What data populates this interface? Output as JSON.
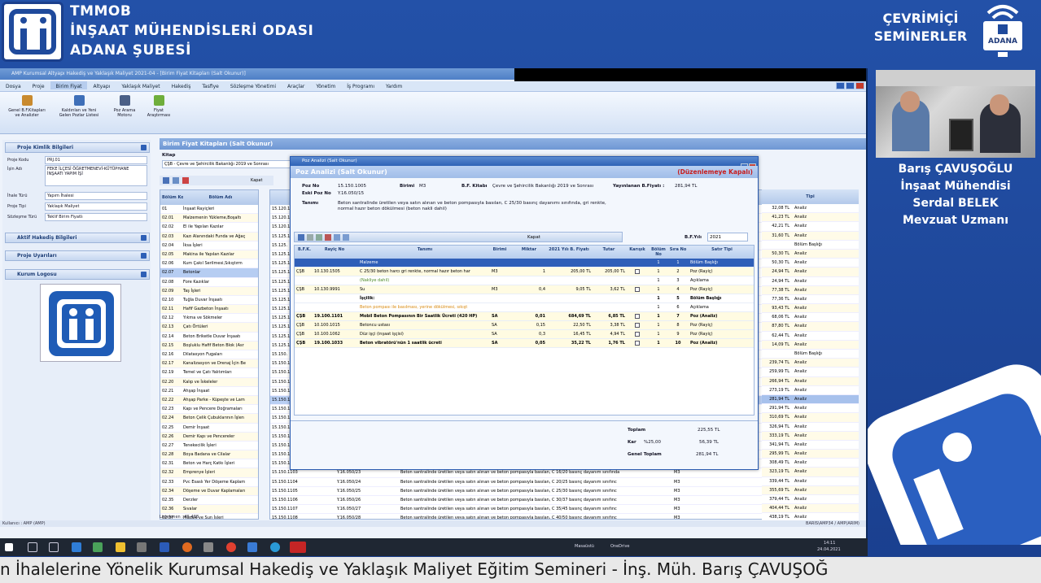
{
  "header": {
    "line1": "TMMOB",
    "line2": "İNŞAAT MÜHENDİSLERİ ODASI",
    "line3": "ADANA ŞUBESİ",
    "right_line1": "ÇEVRİMİÇİ",
    "right_line2": "SEMİNERLER",
    "right_badge": "ADANA"
  },
  "app": {
    "title": "AMP Kurumsal Altyapı Hakediş ve Yaklaşık Maliyet 2021-04 - [Birim Fiyat Kitapları (Salt Okunur)]",
    "menu": [
      "Dosya",
      "Proje",
      "Birim Fiyat",
      "Altyapı",
      "Yaklaşık Maliyet",
      "Hakediş",
      "Tasfiye",
      "Sözleşme Yönetimi",
      "Araçlar",
      "Yönetim",
      "İş Programı",
      "Yardım"
    ],
    "ribbon": [
      {
        "l1": "Genel B.F.Kitapları",
        "l2": "ve Analizler",
        "color": "#c98a2e"
      },
      {
        "l1": "Kaldırılan ve Yeni",
        "l2": "Gelen Pozlar Listesi",
        "color": "#3e6fb8"
      },
      {
        "l1": "Poz Arama",
        "l2": "Motoru",
        "color": "#4a5f86"
      },
      {
        "l1": "Fiyat",
        "l2": "Araştırması",
        "color": "#6fae3b"
      }
    ]
  },
  "left": {
    "g1": "Proje Kimlik Bilgileri",
    "proje_kodu_l": "Proje Kodu",
    "proje_kodu": "PRJ.01",
    "isin_adi_l": "İşin Adı",
    "isin_adi": "FEKE İLÇESİ ÖĞRETMENEVİ-KÜTÜPHANE İNŞAATI YAPIM İŞİ",
    "ihale_turu_l": "İhale Türü",
    "ihale_turu": "Yapım İhalesi",
    "proje_tipi_l": "Proje Tipi",
    "proje_tipi": "Yaklaşık Maliyet",
    "sozlesme_turu_l": "Sözleşme Türü",
    "sozlesme_turu": "Teklif Birim Fiyatlı",
    "g2": "Aktif Hakediş Bilgileri",
    "g3": "Proje Uyarıları",
    "g4": "Kurum Logosu"
  },
  "bfk": {
    "title": "Birim Fiyat Kitapları (Salt Okunur)",
    "kitap_l": "Kitap",
    "kitap": "ÇŞB - Çevre ve Şehircilik Bakanlığı 2019 ve Sonrası",
    "kapat": "Kapat",
    "col_kod": "Bölüm Kodu",
    "col_adi": "Bölüm Adı",
    "col_tipi": "Tipi",
    "listeler": "Listelenen : 45.498",
    "status_left": "Kullanıcı : AMP (AMP)",
    "status_right": "BARIS\\AMP34 / AMP(ARIM)",
    "rows": [
      [
        "01",
        "İnşaat Rayiçleri"
      ],
      [
        "02.01",
        "Malzemenin Yükleme,Boşaltı"
      ],
      [
        "02.02",
        "El ile Yapılan Kazılar"
      ],
      [
        "02.03",
        "Kazı Alanındaki Funda ve Ağaç"
      ],
      [
        "02.04",
        "İksa İşleri"
      ],
      [
        "02.05",
        "Makina ile Yapılan Kazılar"
      ],
      [
        "02.06",
        "Kum Çakıl Serilmesi,Sıkıştırm"
      ],
      [
        "02.07",
        "Betonlar"
      ],
      [
        "02.08",
        "Fore Kazıklar"
      ],
      [
        "02.09",
        "Taş İşleri"
      ],
      [
        "02.10",
        "Tuğla Duvar İnşaatı"
      ],
      [
        "02.11",
        "Hafif Gazbeton İnşaatı"
      ],
      [
        "02.12",
        "Yıkma ve Sökmeler"
      ],
      [
        "02.13",
        "Çatı Örtüleri"
      ],
      [
        "02.14",
        "Beton Briketle Duvar İnşaatı"
      ],
      [
        "02.15",
        "Boşluklu Hafif Beton Blok (Asr"
      ],
      [
        "02.16",
        "Dilatasyon Fugaları"
      ],
      [
        "02.17",
        "Kanalizasyon ve Drenaj İçin Be"
      ],
      [
        "02.19",
        "Temel ve Çatı Yalıtımları"
      ],
      [
        "02.20",
        "Kalıp ve İskeleler"
      ],
      [
        "02.21",
        "Ahşap İnşaat"
      ],
      [
        "02.22",
        "Ahşap Parke - Küpeşte ve Lam"
      ],
      [
        "02.23",
        "Kapı ve Pencere Doğramaları"
      ],
      [
        "02.24",
        "Beton Çelik Çubuklarının İşlen"
      ],
      [
        "02.25",
        "Demir İnşaat"
      ],
      [
        "02.26",
        "Demir Kapı ve Pencereler"
      ],
      [
        "02.27",
        "Tenekecilik İşleri"
      ],
      [
        "02.28",
        "Boya Badana ve Cilalar"
      ],
      [
        "02.31",
        "Beton ve Harç Katkı İşleri"
      ],
      [
        "02.32",
        "Emprenye İşleri"
      ],
      [
        "02.33",
        "Pvc Esaslı Yer Döşeme Kaplam"
      ],
      [
        "02.34",
        "Döşeme ve Duvar Kaplamaları"
      ],
      [
        "02.35",
        "Derzler"
      ],
      [
        "02.36",
        "Sıvalar"
      ],
      [
        "02.37",
        "Mozaik ve Sun İşleri"
      ]
    ],
    "mid": [
      [
        "15.120.1",
        "",
        ""
      ],
      [
        "15.120.1",
        "",
        ""
      ],
      [
        "15.120.1",
        "",
        ""
      ],
      [
        "15.125.1",
        "",
        ""
      ],
      [
        "15.125.",
        "",
        ""
      ],
      [
        "15.125.1",
        "",
        ""
      ],
      [
        "15.125.1",
        "",
        ""
      ],
      [
        "15.125.1",
        "",
        ""
      ],
      [
        "15.125.1",
        "",
        ""
      ],
      [
        "15.125.1",
        "",
        ""
      ],
      [
        "15.125.1",
        "",
        ""
      ],
      [
        "15.125.1",
        "",
        ""
      ],
      [
        "15.125.1",
        "",
        ""
      ],
      [
        "15.125.1",
        "",
        ""
      ],
      [
        "15.125.1",
        "",
        ""
      ],
      [
        "15.125.1",
        "",
        ""
      ],
      [
        "15.150.",
        "",
        ""
      ],
      [
        "15.150.1",
        "",
        ""
      ],
      [
        "15.150.1",
        "",
        ""
      ],
      [
        "15.150.1",
        "",
        ""
      ],
      [
        "15.150.1",
        "",
        ""
      ],
      [
        "15.150.1",
        "",
        ""
      ],
      [
        "15.150.1",
        "",
        ""
      ],
      [
        "15.150.1",
        "",
        ""
      ],
      [
        "15.150.1",
        "",
        ""
      ],
      [
        "15.150.1",
        "",
        ""
      ],
      [
        "15.150.1",
        "",
        ""
      ],
      [
        "15.150.1",
        "",
        ""
      ],
      [
        "15.150.1",
        "",
        ""
      ],
      [
        "15.150.1103",
        "Y.16.050/23",
        "Beton santralinde üretilen veya satın alınan ve beton pompasıyla basılan, C 16/20 basınç dayanım sınıfında",
        "M3"
      ],
      [
        "15.150.1104",
        "Y.16.050/24",
        "Beton santralinde üretilen veya satın alınan ve beton pompasıyla basılan, C 20/25 basınç dayanım sınıfınc",
        "M3"
      ],
      [
        "15.150.1105",
        "Y.16.050/25",
        "Beton santralinde üretilen veya satın alınan ve beton pompasıyla basılan, C 25/30 basınç dayanım sınıfınc",
        "M3"
      ],
      [
        "15.150.1106",
        "Y.16.050/26",
        "Beton santralinde üretilen veya satın alınan ve beton pompasıyla basılan, C 30/37 basınç dayanım sınıfınc",
        "M3"
      ],
      [
        "15.150.1107",
        "Y.16.050/27",
        "Beton santralinde üretilen veya satın alınan ve beton pompasıyla basılan, C 35/45 basınç dayanım sınıfınc",
        "M3"
      ],
      [
        "15.150.1108",
        "Y.16.050/28",
        "Beton santralinde üretilen veya satın alınan ve beton pompasıyla basılan, C 40/50 basınç dayanım sınıfınc",
        "M3"
      ]
    ],
    "right": [
      [
        "32,08 TL",
        "Analiz"
      ],
      [
        "41,23 TL",
        "Analiz"
      ],
      [
        "42,21 TL",
        "Analiz"
      ],
      [
        "31,60 TL",
        "Analiz"
      ],
      [
        "",
        "Bölüm Başlığı"
      ],
      [
        "50,30 TL",
        "Analiz"
      ],
      [
        "50,30 TL",
        "Analiz"
      ],
      [
        "24,94 TL",
        "Analiz"
      ],
      [
        "24,94 TL",
        "Analiz"
      ],
      [
        "77,38 TL",
        "Analiz"
      ],
      [
        "77,36 TL",
        "Analiz"
      ],
      [
        "93,43 TL",
        "Analiz"
      ],
      [
        "68,06 TL",
        "Analiz"
      ],
      [
        "87,80 TL",
        "Analiz"
      ],
      [
        "62,44 TL",
        "Analiz"
      ],
      [
        "14,09 TL",
        "Analiz"
      ],
      [
        "",
        "Bölüm Başlığı"
      ],
      [
        "239,74 TL",
        "Analiz"
      ],
      [
        "259,99 TL",
        "Analiz"
      ],
      [
        "266,94 TL",
        "Analiz"
      ],
      [
        "273,19 TL",
        "Analiz"
      ],
      [
        "281,94 TL",
        "Analiz"
      ],
      [
        "291,94 TL",
        "Analiz"
      ],
      [
        "310,69 TL",
        "Analiz"
      ],
      [
        "326,94 TL",
        "Analiz"
      ],
      [
        "333,19 TL",
        "Analiz"
      ],
      [
        "341,94 TL",
        "Analiz"
      ],
      [
        "295,99 TL",
        "Analiz"
      ],
      [
        "308,49 TL",
        "Analiz"
      ],
      [
        "323,19 TL",
        "Analiz"
      ],
      [
        "339,44 TL",
        "Analiz"
      ],
      [
        "355,69 TL",
        "Analiz"
      ],
      [
        "379,44 TL",
        "Analiz"
      ],
      [
        "404,44 TL",
        "Analiz"
      ],
      [
        "438,19 TL",
        "Analiz"
      ]
    ]
  },
  "dialog": {
    "window_title": "Poz Analizi (Salt Okunur)",
    "title": "Poz Analizi (Salt Okunur)",
    "warning": "(Düzenlemeye Kapalı)",
    "poz_no_l": "Poz No",
    "poz_no": "15.150.1005",
    "eski_poz_l": "Eski Poz No",
    "eski_poz": "Y.16.050/15",
    "birimi_l": "Birimi",
    "birimi": "M3",
    "bfk_l": "B.F. Kitabı",
    "bfk": "Çevre ve Şehircilik Bakanlığı 2019 ve Sonrası",
    "yay_l": "Yayınlanan B.Fiyatı :",
    "yay": "281,94 TL",
    "tanimi_l": "Tanımı",
    "tanimi": "Beton santralinde üretilen veya satın alınan ve beton pompasıyla basılan, C 25/30 basınç dayanımı sınıfında, gri renkte, normal hazır beton dökülmesi (beton nakli dahil)",
    "kapat": "Kapat",
    "bfyili_l": "B.F.Yılı",
    "bfyili": "2021",
    "cols": [
      "B.F.K.",
      "Rayiç No",
      "Tanımı",
      "Birimi",
      "Miktar",
      "2021 Yılı B. Fiyatı",
      "Tutar",
      "Karışık",
      "Bölüm No",
      "Sıra No",
      "Satır Tipi"
    ],
    "rows": [
      {
        "cls": "hdr",
        "bfk": "",
        "no": "",
        "t": "Malzeme",
        "b": "",
        "m": "",
        "f": "",
        "tu": "",
        "bn": "1",
        "sn": "1",
        "st": "Bölüm Başlığı"
      },
      {
        "cls": "yel",
        "bfk": "ÇŞB",
        "no": "10.130.1505",
        "t": "C 25/30 beton harcı gri renkte, normal hazır beton har",
        "b": "M3",
        "m": "1",
        "f": "205,00 TL",
        "tu": "205,00 TL",
        "bn": "1",
        "sn": "2",
        "st": "Poz (Rayiç)"
      },
      {
        "cls": "green",
        "bfk": "",
        "no": "",
        "t": "(Nakliye dahil)",
        "b": "",
        "m": "",
        "f": "",
        "tu": "",
        "bn": "1",
        "sn": "3",
        "st": "Açıklama"
      },
      {
        "cls": "yel",
        "bfk": "ÇŞB",
        "no": "10.130.9991",
        "t": "Su",
        "b": "M3",
        "m": "0,4",
        "f": "9,05 TL",
        "tu": "3,62 TL",
        "bn": "1",
        "sn": "4",
        "st": "Poz (Rayiç)"
      },
      {
        "cls": "bold",
        "bfk": "",
        "no": "",
        "t": "İşçilik:",
        "b": "",
        "m": "",
        "f": "",
        "tu": "",
        "bn": "1",
        "sn": "5",
        "st": "Bölüm Başlığı"
      },
      {
        "cls": "orange",
        "bfk": "",
        "no": "",
        "t": "Beton pompası ile basılması, yerine dökülmesi, sıkışt",
        "b": "",
        "m": "",
        "f": "",
        "tu": "",
        "bn": "1",
        "sn": "6",
        "st": "Açıklama"
      },
      {
        "cls": "yel bold",
        "bfk": "ÇŞB",
        "no": "19.100.1101",
        "t": "Mobil Beton Pompasının Bir Saatlik Ücreti (420 HP)",
        "b": "SA",
        "m": "0,01",
        "f": "684,69 TL",
        "tu": "6,85 TL",
        "bn": "1",
        "sn": "7",
        "st": "Poz (Analiz)"
      },
      {
        "cls": "yel",
        "bfk": "ÇŞB",
        "no": "10.100.1015",
        "t": "Betoncu ustası",
        "b": "SA",
        "m": "0,15",
        "f": "22,50 TL",
        "tu": "3,38 TL",
        "bn": "1",
        "sn": "8",
        "st": "Poz (Rayiç)"
      },
      {
        "cls": "yel",
        "bfk": "ÇŞB",
        "no": "10.100.1062",
        "t": "Düz işçi (inşaat işçisi)",
        "b": "SA",
        "m": "0,3",
        "f": "16,45 TL",
        "tu": "4,94 TL",
        "bn": "1",
        "sn": "9",
        "st": "Poz (Rayiç)"
      },
      {
        "cls": "yel bold",
        "bfk": "ÇŞB",
        "no": "19.100.1033",
        "t": "Beton vibratörü'nün 1 saatlik ücreti",
        "b": "SA",
        "m": "0,05",
        "f": "35,22 TL",
        "tu": "1,76 TL",
        "bn": "1",
        "sn": "10",
        "st": "Poz (Analiz)"
      }
    ],
    "toplam_l": "Toplam",
    "toplam": "225,55 TL",
    "kar_l": "Kar",
    "kar_pct": "%25,00",
    "kar": "56,39 TL",
    "genel_l": "Genel Toplam",
    "genel": "281,94 TL"
  },
  "speaker": {
    "l1": "Barış ÇAVUŞOĞLU",
    "l2": "İnşaat Mühendisi",
    "l3": "Serdal BELEK",
    "l4": "Mevzuat Uzmanı"
  },
  "taskbar": {
    "masaustu": "Masaüstü",
    "onedrive": "OneDrive",
    "time": "14:11",
    "date": "24.04.2021"
  },
  "ticker": "n İhalelerine Yönelik Kurumsal Hakediş ve Yaklaşık Maliyet Eğitim Semineri  - İnş. Müh. Barış ÇAVUŞOĞ"
}
